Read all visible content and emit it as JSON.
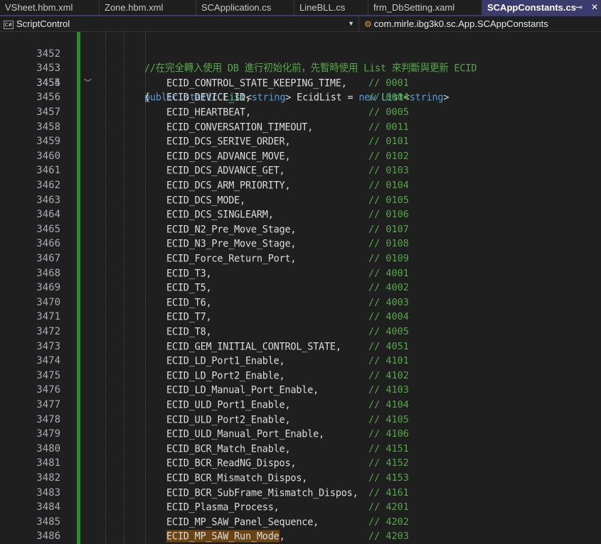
{
  "tabs": [
    {
      "label": "VSheet.hbm.xml",
      "active": false
    },
    {
      "label": "Zone.hbm.xml",
      "active": false
    },
    {
      "label": "SCApplication.cs",
      "active": false
    },
    {
      "label": "LineBLL.cs",
      "active": false
    },
    {
      "label": "frm_DbSetting.xaml",
      "active": false
    },
    {
      "label": "SCAppConstants.cs",
      "active": true
    }
  ],
  "tab_actions": {
    "pin": "⊸",
    "close": "✕"
  },
  "navbar": {
    "project": "ScriptControl",
    "project_icon": "C#",
    "scope": "com.mirle.ibg3k0.sc.App.SCAppConstants"
  },
  "editor": {
    "header_lines": [
      {
        "num": "3452",
        "comment": "//在完全轉入使用 DB 進行初始化前，先暫時使用 List 來判斷與更新 ECID"
      },
      {
        "num": "3453",
        "kw1": "public",
        "kw2": "static",
        "type1": "List",
        "lt1": "<",
        "kw3": "string",
        "gt1": ">",
        "ident": "EcidList",
        "eq": "=",
        "kw4": "new",
        "type2": "List",
        "lt2": "<",
        "kw5": "string",
        "gt2": ">"
      },
      {
        "num": "3454",
        "text": "{"
      }
    ],
    "lines": [
      {
        "num": "3455",
        "code": "ECID_CONTROL_STATE_KEEPING_TIME,",
        "comment": "// 0001"
      },
      {
        "num": "3456",
        "code": "ECID_DEVICE_ID,",
        "comment": "// 0004"
      },
      {
        "num": "3457",
        "code": "ECID_HEARTBEAT,",
        "comment": "// 0005"
      },
      {
        "num": "3458",
        "code": "ECID_CONVERSATION_TIMEOUT,",
        "comment": "// 0011"
      },
      {
        "num": "3459",
        "code": "ECID_DCS_SERIVE_ORDER,",
        "comment": "// 0101"
      },
      {
        "num": "3460",
        "code": "ECID_DCS_ADVANCE_MOVE,",
        "comment": "// 0102"
      },
      {
        "num": "3461",
        "code": "ECID_DCS_ADVANCE_GET,",
        "comment": "// 0103"
      },
      {
        "num": "3462",
        "code": "ECID_DCS_ARM_PRIORITY,",
        "comment": "// 0104"
      },
      {
        "num": "3463",
        "code": "ECID_DCS_MODE,",
        "comment": "// 0105"
      },
      {
        "num": "3464",
        "code": "ECID_DCS_SINGLEARM,",
        "comment": "// 0106"
      },
      {
        "num": "3465",
        "code": "ECID_N2_Pre_Move_Stage,",
        "comment": "// 0107"
      },
      {
        "num": "3466",
        "code": "ECID_N3_Pre_Move_Stage,",
        "comment": "// 0108"
      },
      {
        "num": "3467",
        "code": "ECID_Force_Return_Port,",
        "comment": "// 0109"
      },
      {
        "num": "3468",
        "code": "ECID_T3,",
        "comment": "// 4001"
      },
      {
        "num": "3469",
        "code": "ECID_T5,",
        "comment": "// 4002"
      },
      {
        "num": "3470",
        "code": "ECID_T6,",
        "comment": "// 4003"
      },
      {
        "num": "3471",
        "code": "ECID_T7,",
        "comment": "// 4004"
      },
      {
        "num": "3472",
        "code": "ECID_T8,",
        "comment": "// 4005"
      },
      {
        "num": "3473",
        "code": "ECID_GEM_INITIAL_CONTROL_STATE,",
        "comment": "// 4051"
      },
      {
        "num": "3474",
        "code": "ECID_LD_Port1_Enable,",
        "comment": "// 4101"
      },
      {
        "num": "3475",
        "code": "ECID_LD_Port2_Enable,",
        "comment": "// 4102"
      },
      {
        "num": "3476",
        "code": "ECID_LD_Manual_Port_Enable,",
        "comment": "// 4103"
      },
      {
        "num": "3477",
        "code": "ECID_ULD_Port1_Enable,",
        "comment": "// 4104"
      },
      {
        "num": "3478",
        "code": "ECID_ULD_Port2_Enable,",
        "comment": "// 4105"
      },
      {
        "num": "3479",
        "code": "ECID_ULD_Manual_Port_Enable,",
        "comment": "// 4106"
      },
      {
        "num": "3480",
        "code": "ECID_BCR_Match_Enable,",
        "comment": "// 4151"
      },
      {
        "num": "3481",
        "code": "ECID_BCR_ReadNG_Dispos,",
        "comment": "// 4152"
      },
      {
        "num": "3482",
        "code": "ECID_BCR_Mismatch_Dispos,",
        "comment": "// 4153"
      },
      {
        "num": "3483",
        "code": "ECID_BCR_SubFrame_Mismatch_Dispos,",
        "comment": "// 4161"
      },
      {
        "num": "3484",
        "code": "ECID_Plasma_Process,",
        "comment": "// 4201"
      },
      {
        "num": "3485",
        "code": "ECID_MP_SAW_Panel_Sequence,",
        "comment": "// 4202"
      },
      {
        "num": "3486",
        "code": "ECID_MP_SAW_Run_Mode",
        "suffix": ",",
        "comment": "// 4203",
        "highlighted": true
      }
    ]
  },
  "colors": {
    "background": "#1f1f1f",
    "active_tab": "#3b3b6e",
    "keyword": "#569cd6",
    "type": "#4ec9b0",
    "comment": "#57a64a",
    "identifier": "#dcdcdc",
    "change_bar": "#2e8a2e",
    "highlight": "#6a4414"
  }
}
